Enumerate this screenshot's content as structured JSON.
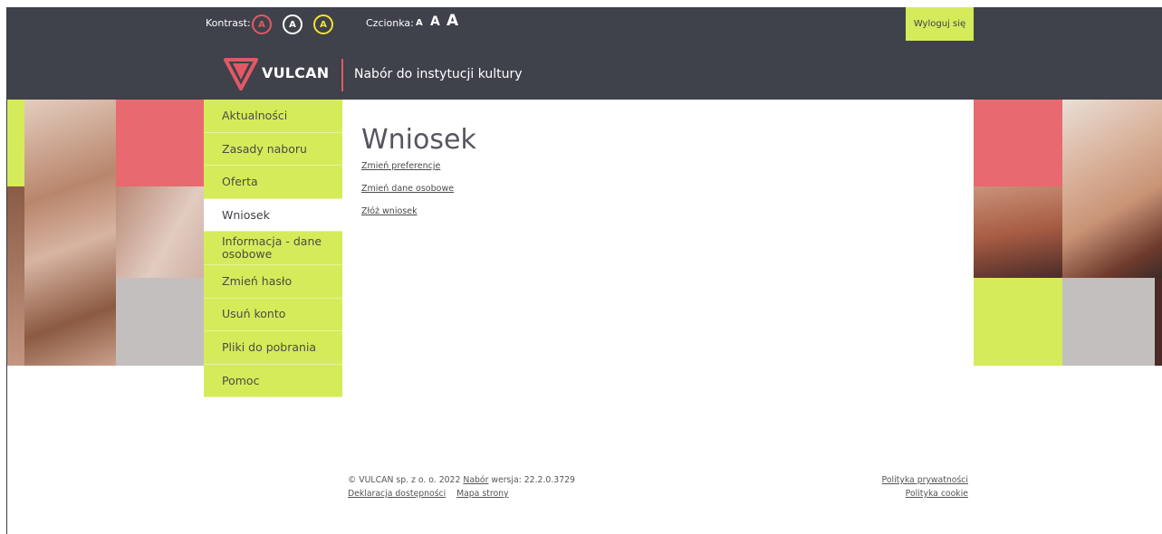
{
  "header": {
    "contrast_label": "Kontrast:",
    "contrast_buttons": [
      "A",
      "A",
      "A"
    ],
    "font_label": "Czcionka:",
    "font_sizes": [
      "A",
      "A",
      "A"
    ],
    "logout": "Wyloguj się",
    "brand": "VULCAN",
    "app_title": "Nabór do instytucji kultury"
  },
  "nav": {
    "items": [
      {
        "label": "Aktualności"
      },
      {
        "label": "Zasady naboru"
      },
      {
        "label": "Oferta"
      },
      {
        "label": "Wniosek"
      },
      {
        "label": "Informacja - dane osobowe"
      },
      {
        "label": "Zmień hasło"
      },
      {
        "label": "Usuń konto"
      },
      {
        "label": "Pliki do pobrania"
      },
      {
        "label": "Pomoc"
      }
    ],
    "active": "Wniosek"
  },
  "main": {
    "title": "Wniosek",
    "links": [
      "Zmień preferencje",
      "Zmień dane osobowe",
      "Złóż wniosek"
    ]
  },
  "footer": {
    "copyright": "© VULCAN sp. z o. o. 2022",
    "nabor_link": "Nabór",
    "version": "wersja: 22.2.0.3729",
    "accessibility": "Deklaracja dostępności",
    "sitemap": "Mapa strony",
    "privacy": "Polityka prywatności",
    "cookie": "Polityka cookie"
  },
  "colors": {
    "topbar": "#3f414b",
    "accent_lime": "#d6eb5a",
    "accent_pink": "#e8696f"
  }
}
